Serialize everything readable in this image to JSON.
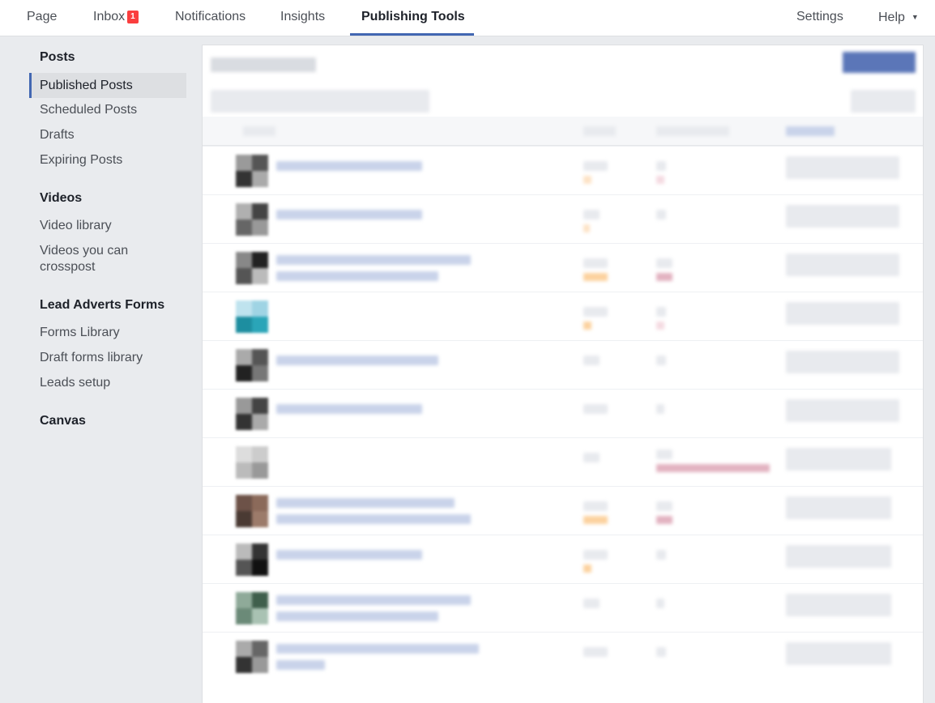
{
  "topnav": {
    "page": "Page",
    "inbox": "Inbox",
    "inbox_badge": "1",
    "notifications": "Notifications",
    "insights": "Insights",
    "publishing_tools": "Publishing Tools",
    "settings": "Settings",
    "help": "Help",
    "help_caret": "▼"
  },
  "sidebar": {
    "posts_heading": "Posts",
    "published_posts": "Published Posts",
    "scheduled_posts": "Scheduled Posts",
    "drafts": "Drafts",
    "expiring_posts": "Expiring Posts",
    "videos_heading": "Videos",
    "video_library": "Video library",
    "videos_crosspost_1": "Videos you can",
    "videos_crosspost_2": "crosspost",
    "lead_heading": "Lead Adverts Forms",
    "forms_library": "Forms Library",
    "draft_forms_library": "Draft forms library",
    "leads_setup": "Leads setup",
    "canvas_heading": "Canvas"
  },
  "colors": {
    "accent": "#4267b2",
    "badge": "#fa3e3e",
    "page_bg": "#e9ebee"
  }
}
